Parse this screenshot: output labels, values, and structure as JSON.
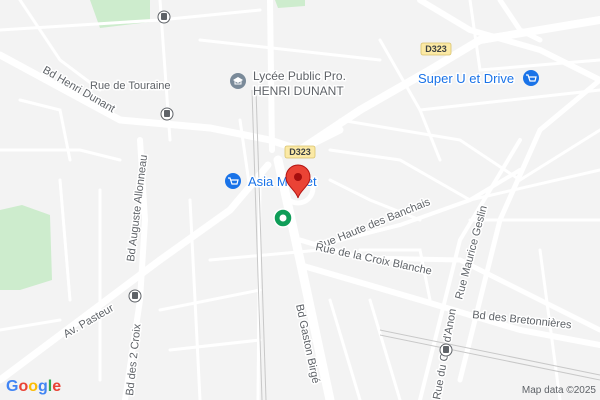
{
  "streets": {
    "rue_de_touraine": "Rue de Touraine",
    "bd_henri_dunant": "Bd Henri Dunant",
    "bd_auguste_allonneau": "Bd Auguste Allonneau",
    "av_pasteur": "Av. Pasteur",
    "bd_des_2_croix": "Bd des 2 Croix",
    "rue_haute_des_banchais": "Rue Haute des Banchais",
    "rue_de_la_croix_blanche": "Rue de la Croix Blanche",
    "bd_des_bretonnieres": "Bd des Bretonnières",
    "bd_gaston_birge": "Bd Gaston Birgé",
    "rue_maurice_geslin": "Rue Maurice Geslin",
    "rue_du_cul_d_anon": "Rue du Cul d'Anon"
  },
  "road_badges": {
    "d323_top": "D323",
    "d323_center": "D323"
  },
  "pois": {
    "lycee_line1": "Lycée Public Pro.",
    "lycee_line2": "HENRI DUNANT",
    "super_u": "Super U et Drive",
    "asia_market": "Asia Market"
  },
  "attribution": "Map data ©2025",
  "google_logo": [
    "G",
    "o",
    "o",
    "g",
    "l",
    "e"
  ],
  "colors": {
    "background": "#f3f3f3",
    "road": "#ffffff",
    "park": "#cdeccd",
    "pin": "#ea4335",
    "poi_blue": "#1a73e8",
    "transit_green": "#0f9d58",
    "badge": "#fbe9a5"
  },
  "icons": {
    "pin": "location-pin-icon",
    "school": "school-icon",
    "shopping": "shopping-cart-icon",
    "bus": "bus-stop-icon",
    "transit": "transit-station-icon"
  }
}
